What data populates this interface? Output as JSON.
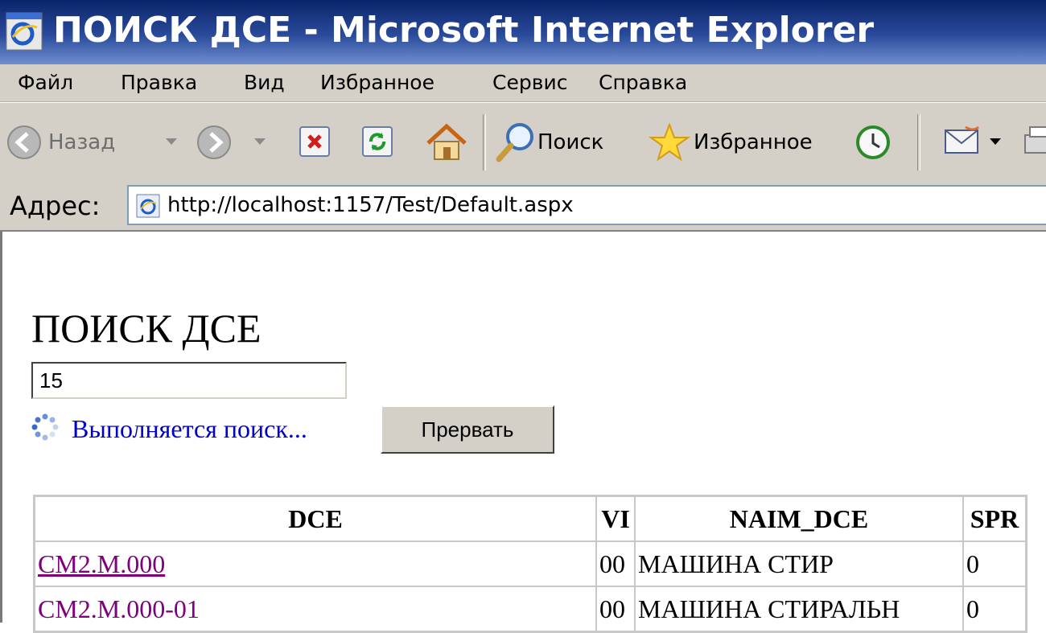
{
  "window": {
    "title": "ПОИСК ДСЕ - Microsoft Internet Explorer"
  },
  "menu": {
    "items": [
      "Файл",
      "Правка",
      "Вид",
      "Избранное",
      "Сервис",
      "Справка"
    ]
  },
  "toolbar": {
    "back_label": "Назад",
    "search_label": "Поиск",
    "favorites_label": "Избранное"
  },
  "address": {
    "label": "Адрес:",
    "url": "http://localhost:1157/Test/Default.aspx"
  },
  "page": {
    "heading": "ПОИСК ДСЕ",
    "search_value": "15",
    "status_text": "Выполняется поиск...",
    "abort_label": "Прервать"
  },
  "table": {
    "headers": [
      "DCE",
      "VI",
      "NAIM_DCE",
      "SPR"
    ],
    "rows": [
      [
        "CM2.M.000",
        "00",
        "МАШИНА СТИР",
        "0"
      ],
      [
        "CM2.M.000-01",
        "00",
        "МАШИНА СТИРАЛЬН",
        "0"
      ]
    ]
  }
}
